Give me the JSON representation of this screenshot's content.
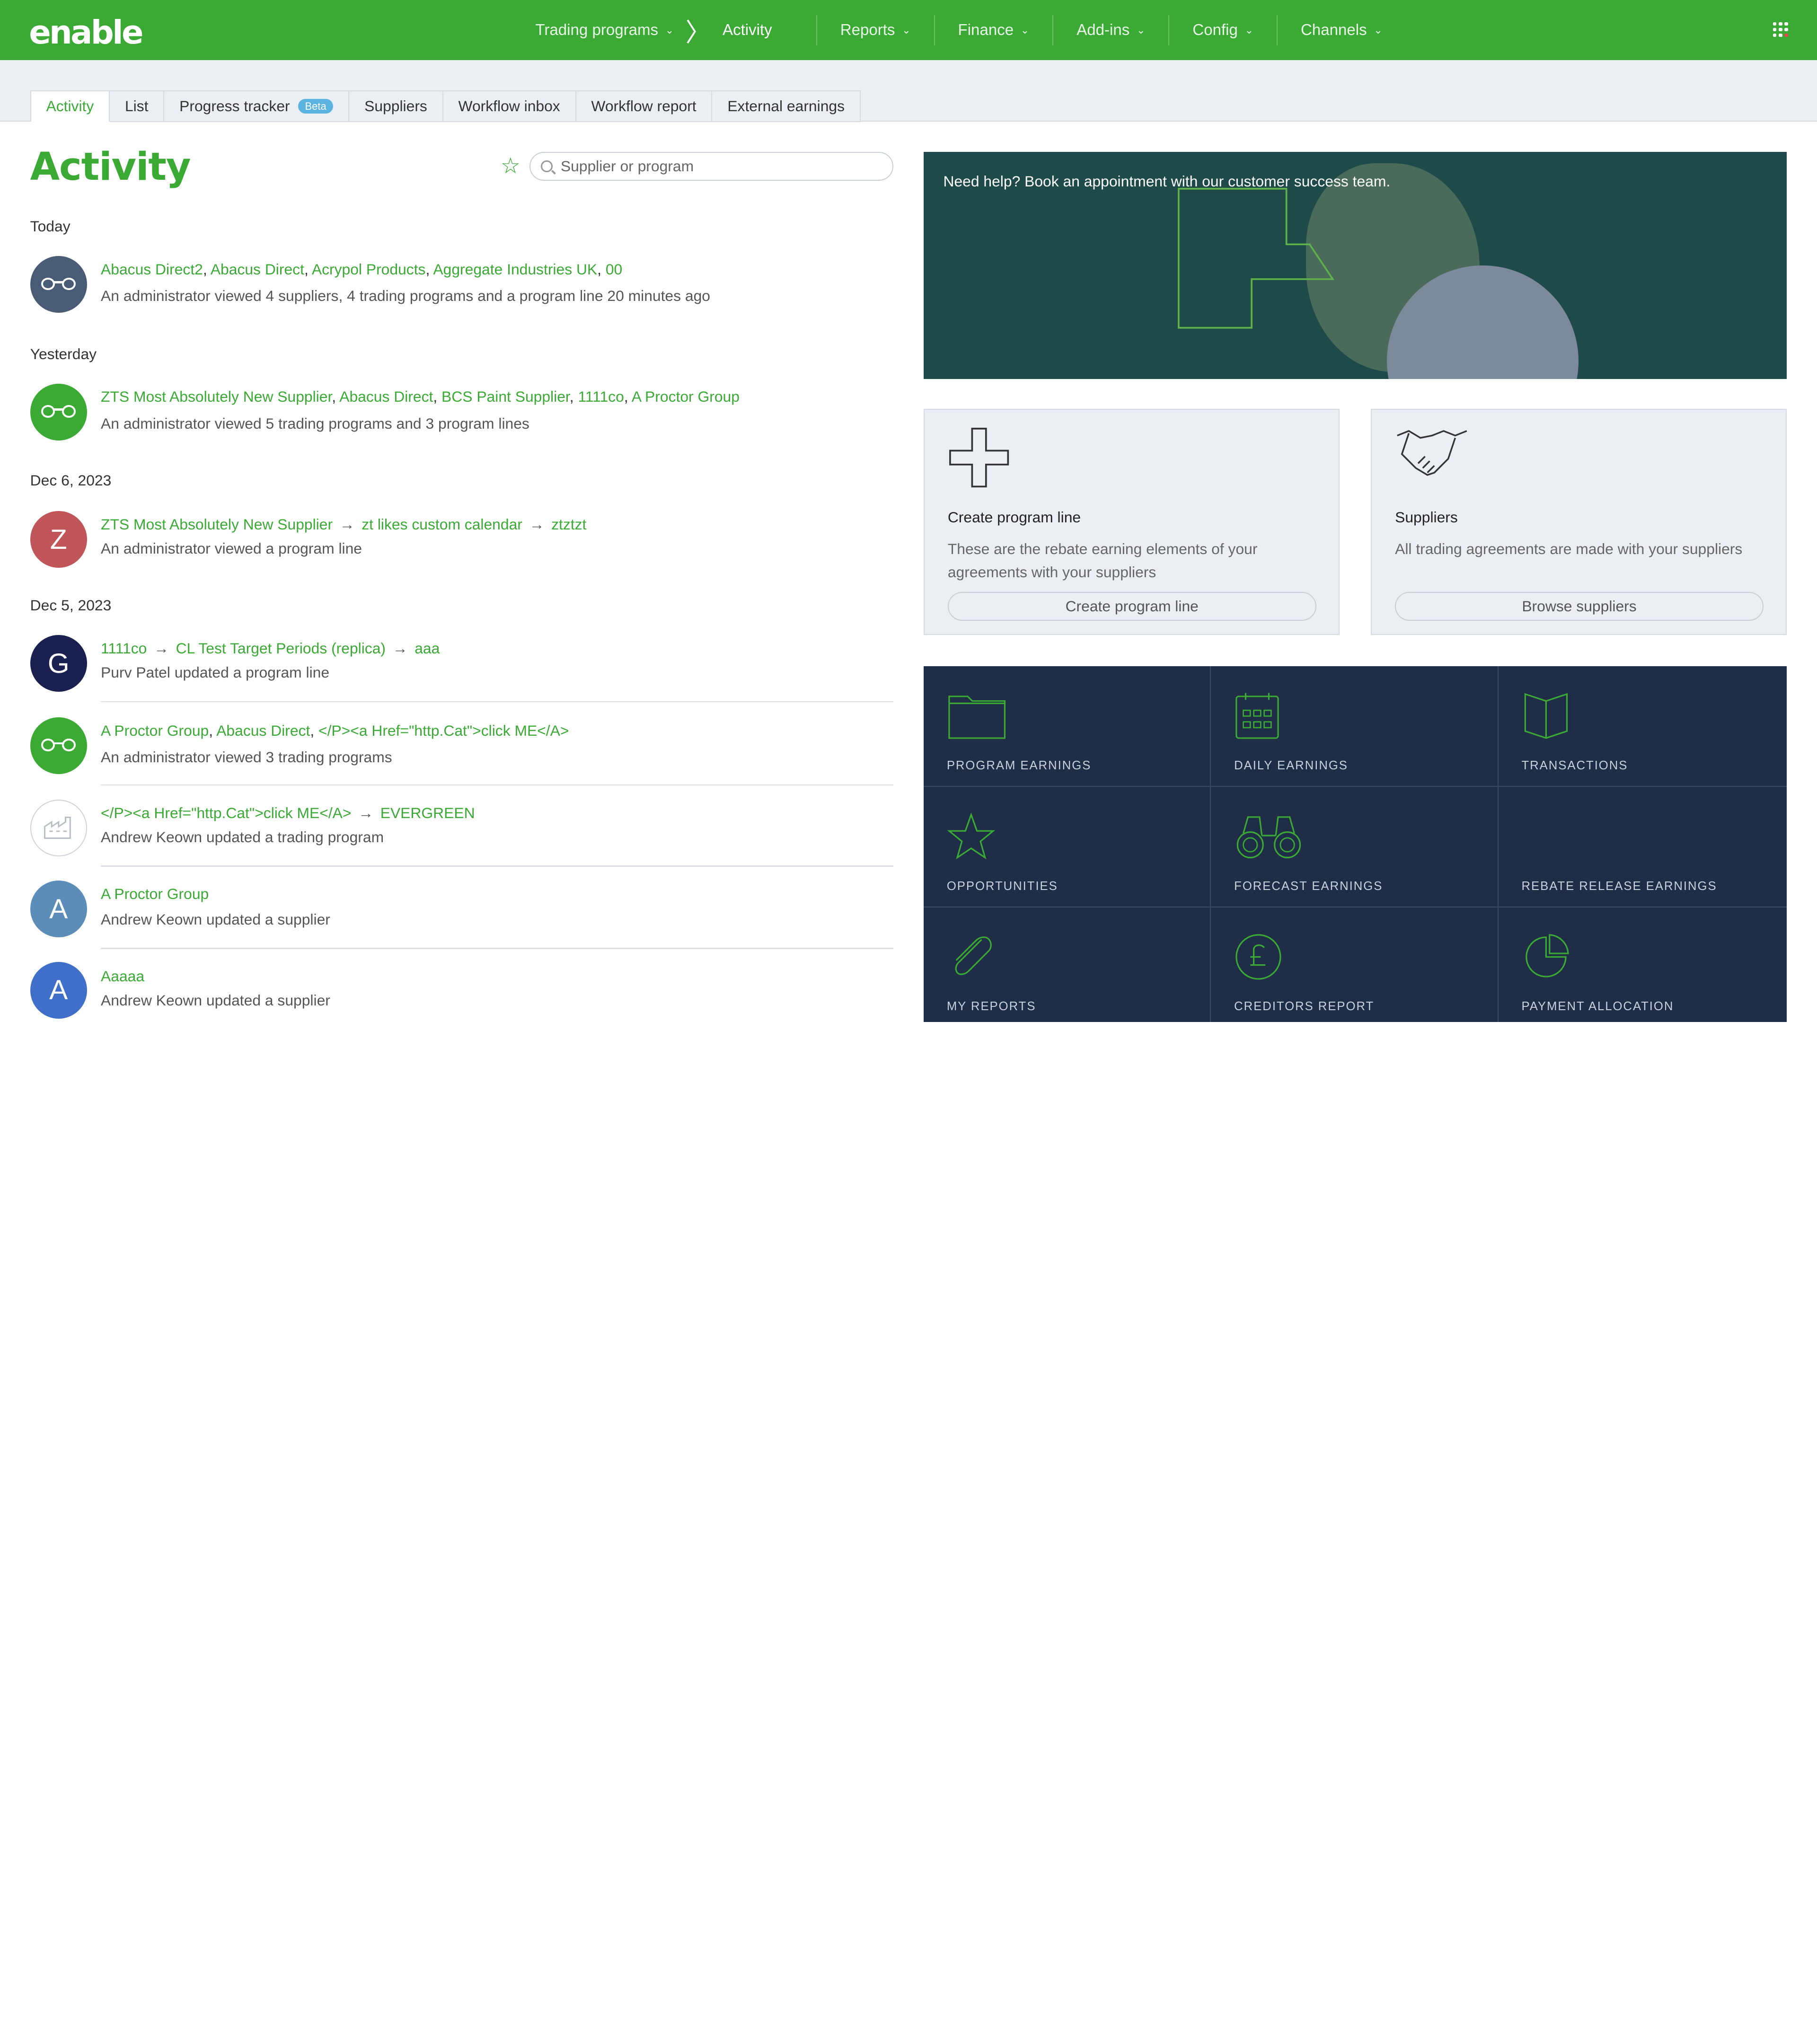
{
  "app": {
    "logo_text": "enable"
  },
  "nav": {
    "items": [
      {
        "label": "Trading programs",
        "chev": "⌄"
      },
      {
        "label": "Activity"
      },
      {
        "label": "Reports",
        "chev": "⌄"
      },
      {
        "label": "Finance",
        "chev": "⌄"
      },
      {
        "label": "Add-ins",
        "chev": "⌄"
      },
      {
        "label": "Config",
        "chev": "⌄"
      },
      {
        "label": "Channels",
        "chev": "⌄"
      }
    ],
    "crumb_sep": "〉"
  },
  "tabs": [
    {
      "label": "Activity"
    },
    {
      "label": "List"
    },
    {
      "label": "Progress tracker",
      "badge": "Beta"
    },
    {
      "label": "Suppliers"
    },
    {
      "label": "Workflow inbox"
    },
    {
      "label": "Workflow report"
    },
    {
      "label": "External earnings"
    }
  ],
  "page": {
    "title": "Activity",
    "search_placeholder": "Supplier or program"
  },
  "activity": {
    "days": [
      "Today",
      "Yesterday",
      "Dec 6, 2023",
      "Dec 5, 2023"
    ],
    "entries": [
      {
        "avatar_letter": "",
        "avatar_color": "#4a5b75",
        "links": [
          "Abacus Direct2",
          "Abacus Direct",
          "Acrypol Products",
          "Aggregate Industries UK",
          "00"
        ],
        "description": "An administrator viewed 4 suppliers, 4 trading programs and a program line 20 minutes ago"
      },
      {
        "avatar_letter": "",
        "avatar_color": "#3aaa35",
        "links": [
          "ZTS Most Absolutely New Supplier",
          "Abacus Direct",
          "BCS Paint Supplier",
          "1111co",
          "A Proctor Group"
        ],
        "description": "An administrator viewed 5 trading programs and 3 program lines"
      },
      {
        "avatar_letter": "Z",
        "avatar_color": "#c0555a",
        "path": [
          "ZTS Most Absolutely New Supplier",
          "zt likes custom calendar",
          "ztztzt"
        ],
        "description": "An administrator viewed a program line"
      },
      {
        "avatar_letter": "G",
        "avatar_color": "#1a2150",
        "path": [
          "1111co",
          "CL Test Target Periods (replica)",
          "aaa"
        ],
        "description": "Purv Patel updated a program line"
      },
      {
        "avatar_letter": "",
        "avatar_color": "#3aaa35",
        "links": [
          "A Proctor Group",
          "Abacus Direct",
          "</P><a Href=\"http.Cat\">click ME</A>"
        ],
        "description": "An administrator viewed 3 trading programs"
      },
      {
        "avatar_letter": "",
        "avatar_color": "#ffffff",
        "path": [
          "</P><a Href=\"http.Cat\">click ME</A>",
          "EVERGREEN"
        ],
        "description": "Andrew Keown updated a trading program"
      },
      {
        "avatar_letter": "A",
        "avatar_color": "#5b8db8",
        "links": [
          "A Proctor Group"
        ],
        "description": "Andrew Keown updated a supplier"
      },
      {
        "avatar_letter": "A",
        "avatar_color": "#3f6fc8",
        "links": [
          "Aaaaa"
        ],
        "description": "Andrew Keown updated a supplier"
      }
    ]
  },
  "hero": {
    "text": "Need help? Book an appointment with our customer success team."
  },
  "cards": [
    {
      "icon": "plus-icon",
      "title": "Create program line",
      "description": "These are the rebate earning elements of your agreements with your suppliers",
      "button": "Create program line"
    },
    {
      "icon": "handshake-icon",
      "title": "Suppliers",
      "description": "All trading agreements are made with your suppliers",
      "button": "Browse suppliers"
    }
  ],
  "tiles": [
    {
      "label": "PROGRAM EARNINGS",
      "icon": "folder-icon"
    },
    {
      "label": "DAILY EARNINGS",
      "icon": "calendar-icon"
    },
    {
      "label": "TRANSACTIONS",
      "icon": "book-icon"
    },
    {
      "label": "OPPORTUNITIES",
      "icon": "star-icon"
    },
    {
      "label": "FORECAST EARNINGS",
      "icon": "binoculars-icon"
    },
    {
      "label": "REBATE RELEASE EARNINGS",
      "icon": ""
    },
    {
      "label": "MY REPORTS",
      "icon": "paperclip-icon"
    },
    {
      "label": "CREDITORS REPORT",
      "icon": "pound-icon"
    },
    {
      "label": "PAYMENT ALLOCATION",
      "icon": "pie-icon"
    }
  ],
  "colors": {
    "brand_green": "#3aaa35",
    "tile_navy": "#1f2d47",
    "hero_teal": "#1f4a4a"
  }
}
